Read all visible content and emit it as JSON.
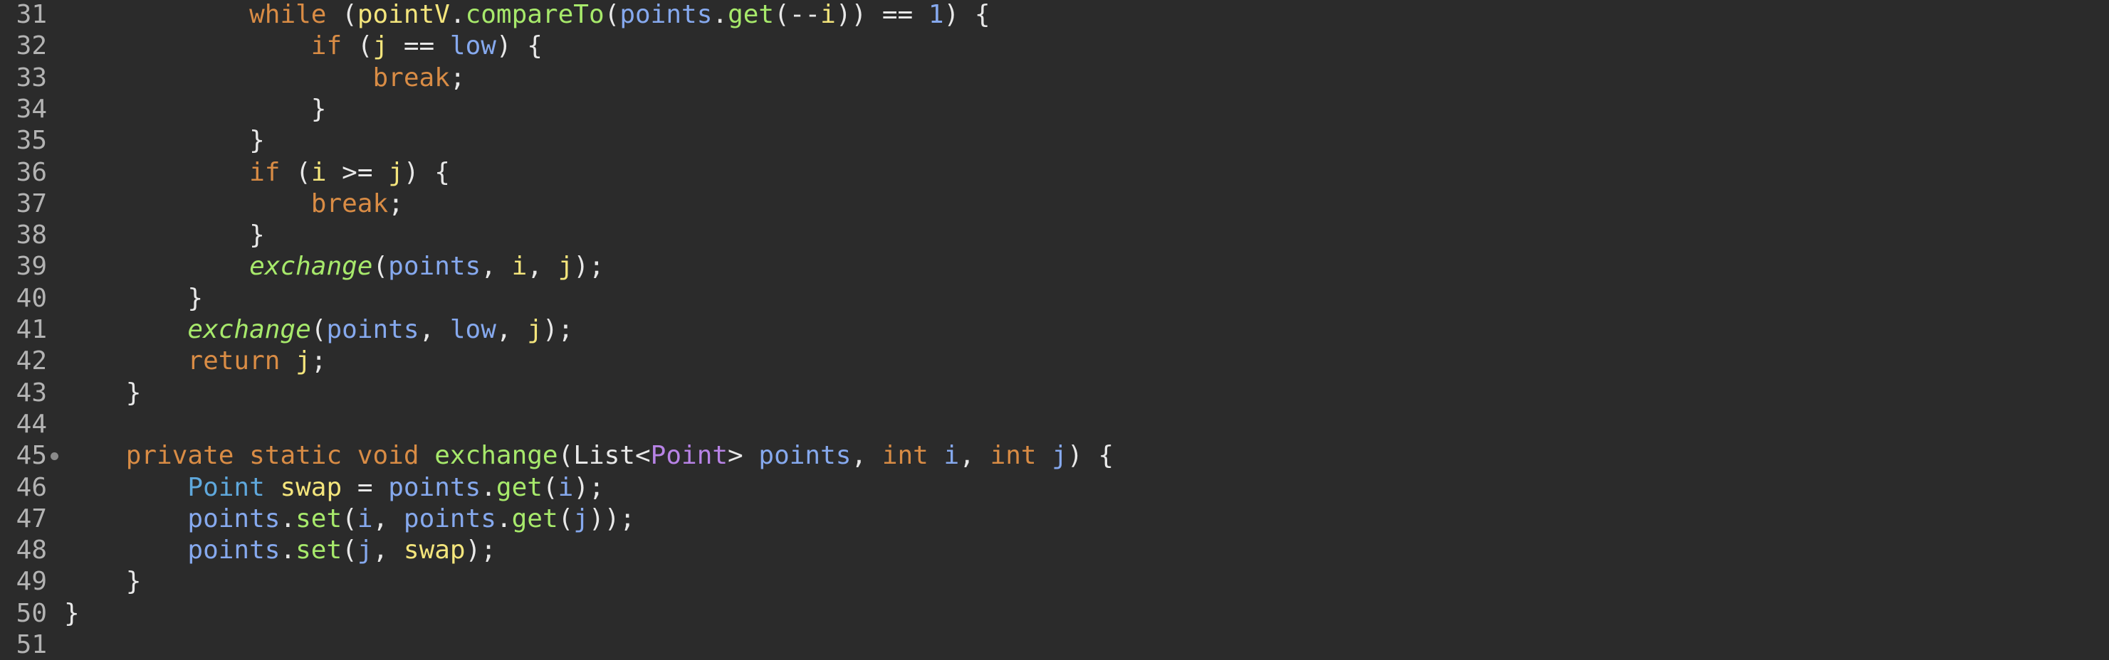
{
  "editor": {
    "lines": [
      {
        "num": "31",
        "tokens": [
          {
            "t": "            ",
            "c": "p"
          },
          {
            "t": "while",
            "c": "kw"
          },
          {
            "t": " (",
            "c": "p"
          },
          {
            "t": "pointV",
            "c": "var"
          },
          {
            "t": ".",
            "c": "p"
          },
          {
            "t": "compareTo",
            "c": "fn"
          },
          {
            "t": "(",
            "c": "p"
          },
          {
            "t": "points",
            "c": "ref"
          },
          {
            "t": ".",
            "c": "p"
          },
          {
            "t": "get",
            "c": "fn"
          },
          {
            "t": "(--",
            "c": "p"
          },
          {
            "t": "i",
            "c": "var"
          },
          {
            "t": ")) == ",
            "c": "p"
          },
          {
            "t": "1",
            "c": "num"
          },
          {
            "t": ") {",
            "c": "p"
          }
        ]
      },
      {
        "num": "32",
        "tokens": [
          {
            "t": "                ",
            "c": "p"
          },
          {
            "t": "if",
            "c": "kw"
          },
          {
            "t": " (",
            "c": "p"
          },
          {
            "t": "j",
            "c": "var"
          },
          {
            "t": " == ",
            "c": "p"
          },
          {
            "t": "low",
            "c": "ref"
          },
          {
            "t": ") {",
            "c": "p"
          }
        ]
      },
      {
        "num": "33",
        "tokens": [
          {
            "t": "                    ",
            "c": "p"
          },
          {
            "t": "break",
            "c": "kw"
          },
          {
            "t": ";",
            "c": "p"
          }
        ]
      },
      {
        "num": "34",
        "tokens": [
          {
            "t": "                }",
            "c": "p"
          }
        ]
      },
      {
        "num": "35",
        "tokens": [
          {
            "t": "            }",
            "c": "p"
          }
        ]
      },
      {
        "num": "36",
        "tokens": [
          {
            "t": "            ",
            "c": "p"
          },
          {
            "t": "if",
            "c": "kw"
          },
          {
            "t": " (",
            "c": "p"
          },
          {
            "t": "i",
            "c": "var"
          },
          {
            "t": " >= ",
            "c": "p"
          },
          {
            "t": "j",
            "c": "var"
          },
          {
            "t": ") {",
            "c": "p"
          }
        ]
      },
      {
        "num": "37",
        "tokens": [
          {
            "t": "                ",
            "c": "p"
          },
          {
            "t": "break",
            "c": "kw"
          },
          {
            "t": ";",
            "c": "p"
          }
        ]
      },
      {
        "num": "38",
        "tokens": [
          {
            "t": "            }",
            "c": "p"
          }
        ]
      },
      {
        "num": "39",
        "tokens": [
          {
            "t": "            ",
            "c": "p"
          },
          {
            "t": "exchange",
            "c": "fni"
          },
          {
            "t": "(",
            "c": "p"
          },
          {
            "t": "points",
            "c": "ref"
          },
          {
            "t": ", ",
            "c": "p"
          },
          {
            "t": "i",
            "c": "var"
          },
          {
            "t": ", ",
            "c": "p"
          },
          {
            "t": "j",
            "c": "var"
          },
          {
            "t": ");",
            "c": "p"
          }
        ]
      },
      {
        "num": "40",
        "tokens": [
          {
            "t": "        }",
            "c": "p"
          }
        ]
      },
      {
        "num": "41",
        "tokens": [
          {
            "t": "        ",
            "c": "p"
          },
          {
            "t": "exchange",
            "c": "fni"
          },
          {
            "t": "(",
            "c": "p"
          },
          {
            "t": "points",
            "c": "ref"
          },
          {
            "t": ", ",
            "c": "p"
          },
          {
            "t": "low",
            "c": "ref"
          },
          {
            "t": ", ",
            "c": "p"
          },
          {
            "t": "j",
            "c": "var"
          },
          {
            "t": ");",
            "c": "p"
          }
        ]
      },
      {
        "num": "42",
        "tokens": [
          {
            "t": "        ",
            "c": "p"
          },
          {
            "t": "return",
            "c": "kw"
          },
          {
            "t": " ",
            "c": "p"
          },
          {
            "t": "j",
            "c": "var"
          },
          {
            "t": ";",
            "c": "p"
          }
        ]
      },
      {
        "num": "43",
        "tokens": [
          {
            "t": "    }",
            "c": "p"
          }
        ]
      },
      {
        "num": "44",
        "tokens": []
      },
      {
        "num": "45",
        "marker": true,
        "tokens": [
          {
            "t": "    ",
            "c": "p"
          },
          {
            "t": "private static void",
            "c": "kw"
          },
          {
            "t": " ",
            "c": "p"
          },
          {
            "t": "exchange",
            "c": "fn"
          },
          {
            "t": "(",
            "c": "p"
          },
          {
            "t": "List",
            "c": "p"
          },
          {
            "t": "<",
            "c": "p"
          },
          {
            "t": "Point",
            "c": "gen"
          },
          {
            "t": "> ",
            "c": "p"
          },
          {
            "t": "points",
            "c": "ref"
          },
          {
            "t": ", ",
            "c": "p"
          },
          {
            "t": "int",
            "c": "kw"
          },
          {
            "t": " ",
            "c": "p"
          },
          {
            "t": "i",
            "c": "ref"
          },
          {
            "t": ", ",
            "c": "p"
          },
          {
            "t": "int",
            "c": "kw"
          },
          {
            "t": " ",
            "c": "p"
          },
          {
            "t": "j",
            "c": "ref"
          },
          {
            "t": ") {",
            "c": "p"
          }
        ]
      },
      {
        "num": "46",
        "tokens": [
          {
            "t": "        ",
            "c": "p"
          },
          {
            "t": "Point",
            "c": "typ"
          },
          {
            "t": " ",
            "c": "p"
          },
          {
            "t": "swap",
            "c": "var"
          },
          {
            "t": " = ",
            "c": "p"
          },
          {
            "t": "points",
            "c": "ref"
          },
          {
            "t": ".",
            "c": "p"
          },
          {
            "t": "get",
            "c": "fn"
          },
          {
            "t": "(",
            "c": "p"
          },
          {
            "t": "i",
            "c": "ref"
          },
          {
            "t": ");",
            "c": "p"
          }
        ]
      },
      {
        "num": "47",
        "tokens": [
          {
            "t": "        ",
            "c": "p"
          },
          {
            "t": "points",
            "c": "ref"
          },
          {
            "t": ".",
            "c": "p"
          },
          {
            "t": "set",
            "c": "fn"
          },
          {
            "t": "(",
            "c": "p"
          },
          {
            "t": "i",
            "c": "ref"
          },
          {
            "t": ", ",
            "c": "p"
          },
          {
            "t": "points",
            "c": "ref"
          },
          {
            "t": ".",
            "c": "p"
          },
          {
            "t": "get",
            "c": "fn"
          },
          {
            "t": "(",
            "c": "p"
          },
          {
            "t": "j",
            "c": "ref"
          },
          {
            "t": "));",
            "c": "p"
          }
        ]
      },
      {
        "num": "48",
        "tokens": [
          {
            "t": "        ",
            "c": "p"
          },
          {
            "t": "points",
            "c": "ref"
          },
          {
            "t": ".",
            "c": "p"
          },
          {
            "t": "set",
            "c": "fn"
          },
          {
            "t": "(",
            "c": "p"
          },
          {
            "t": "j",
            "c": "ref"
          },
          {
            "t": ", ",
            "c": "p"
          },
          {
            "t": "swap",
            "c": "var"
          },
          {
            "t": ");",
            "c": "p"
          }
        ]
      },
      {
        "num": "49",
        "tokens": [
          {
            "t": "    }",
            "c": "p"
          }
        ]
      },
      {
        "num": "50",
        "tokens": [
          {
            "t": "}",
            "c": "p"
          }
        ]
      },
      {
        "num": "51",
        "tokens": []
      }
    ]
  }
}
